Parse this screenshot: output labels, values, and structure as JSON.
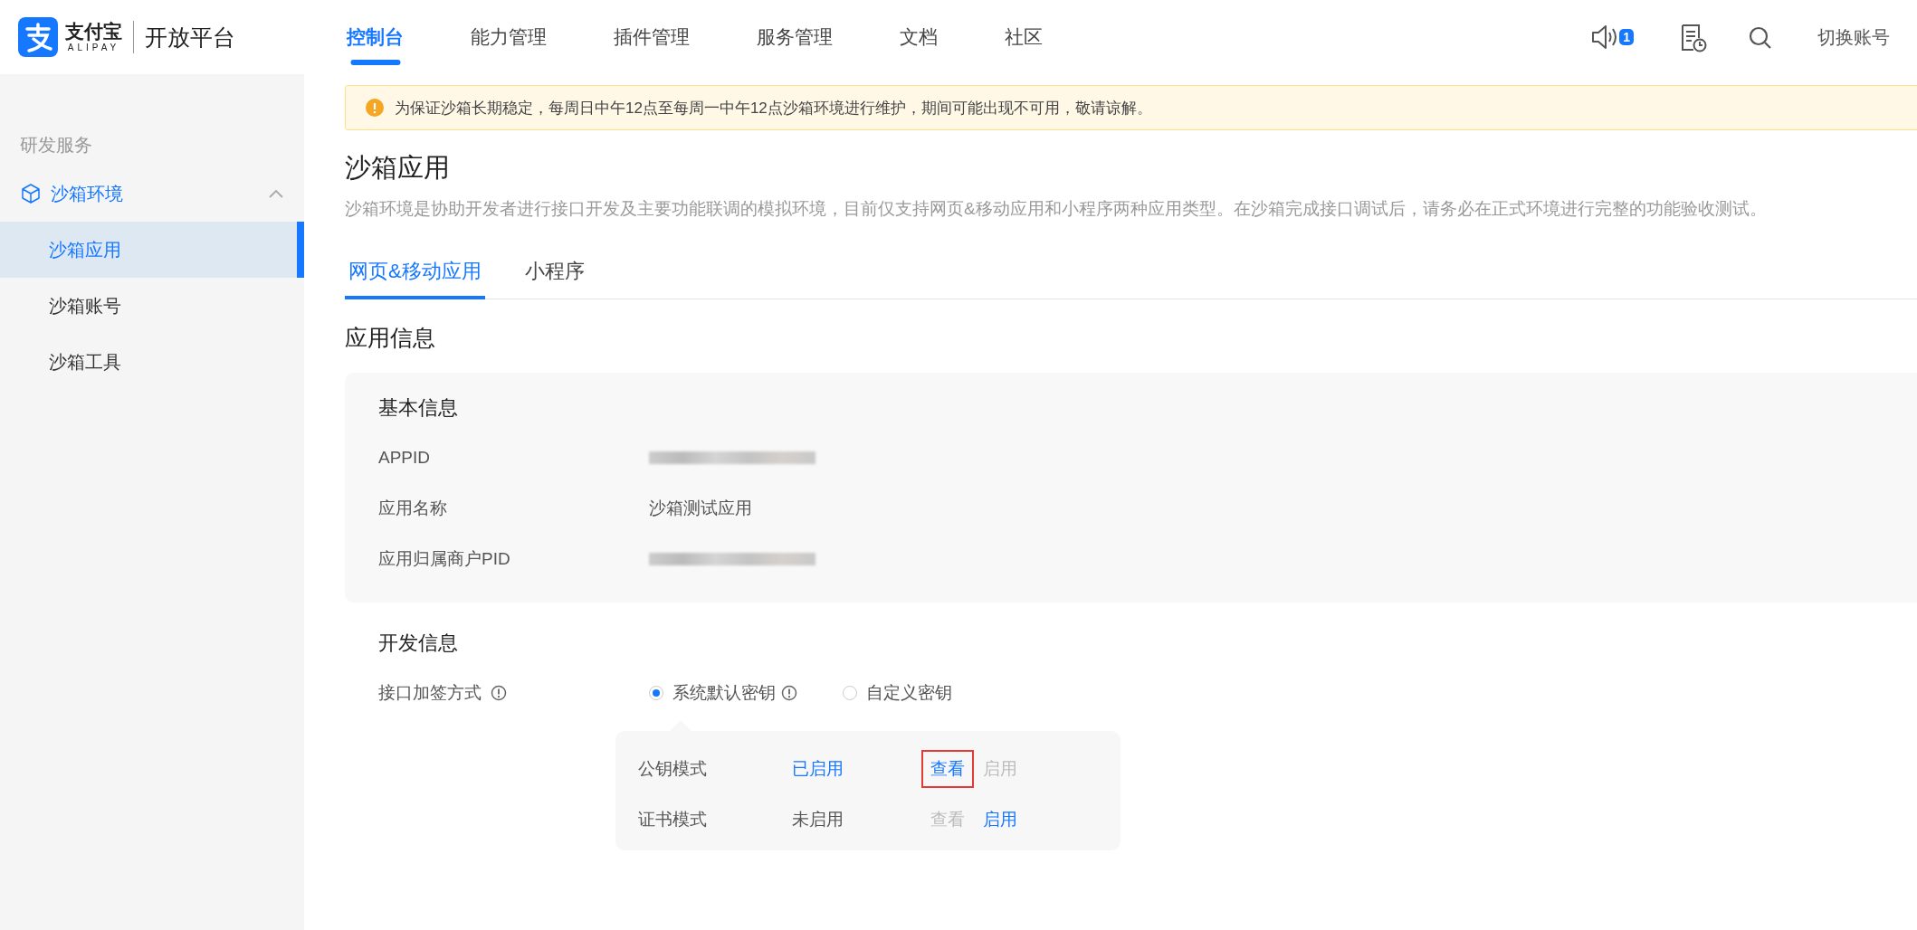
{
  "header": {
    "logo": {
      "name": "支付宝",
      "sub": "ALIPAY"
    },
    "platform": "开放平台",
    "nav": [
      {
        "label": "控制台",
        "selected": true
      },
      {
        "label": "能力管理",
        "selected": false
      },
      {
        "label": "插件管理",
        "selected": false
      },
      {
        "label": "服务管理",
        "selected": false
      },
      {
        "label": "文档",
        "selected": false
      },
      {
        "label": "社区",
        "selected": false
      }
    ],
    "notification_count": "1",
    "switch_account": "切换账号"
  },
  "sidebar": {
    "section": "研发服务",
    "groups": [
      {
        "label": "沙箱环境",
        "expanded": true,
        "children": [
          {
            "label": "沙箱应用",
            "selected": true
          },
          {
            "label": "沙箱账号",
            "selected": false
          },
          {
            "label": "沙箱工具",
            "selected": false
          }
        ]
      }
    ]
  },
  "notice": "为保证沙箱长期稳定，每周日中午12点至每周一中午12点沙箱环境进行维护，期间可能出现不可用，敬请谅解。",
  "page": {
    "title": "沙箱应用",
    "description": "沙箱环境是协助开发者进行接口开发及主要功能联调的模拟环境，目前仅支持网页&移动应用和小程序两种应用类型。在沙箱完成接口调试后，请务必在正式环境进行完整的功能验收测试。",
    "tabs": [
      {
        "label": "网页&移动应用",
        "selected": true
      },
      {
        "label": "小程序",
        "selected": false
      }
    ],
    "section_title": "应用信息",
    "basic_info": {
      "title": "基本信息",
      "fields": [
        {
          "label": "APPID",
          "redacted": true
        },
        {
          "label": "应用名称",
          "value": "沙箱测试应用"
        },
        {
          "label": "应用归属商户PID",
          "redacted": true
        }
      ]
    },
    "dev_info": {
      "title": "开发信息",
      "signing": {
        "label": "接口加签方式",
        "options": [
          {
            "label": "系统默认密钥",
            "selected": true,
            "info": true
          },
          {
            "label": "自定义密钥",
            "selected": false,
            "info": false
          }
        ]
      },
      "modes": [
        {
          "name": "公钥模式",
          "status": "已启用",
          "enabled": true,
          "actions": [
            {
              "label": "查看",
              "disabled": false,
              "highlighted": true
            },
            {
              "label": "启用",
              "disabled": true,
              "highlighted": false
            }
          ]
        },
        {
          "name": "证书模式",
          "status": "未启用",
          "enabled": false,
          "actions": [
            {
              "label": "查看",
              "disabled": true,
              "highlighted": false
            },
            {
              "label": "启用",
              "disabled": false,
              "highlighted": false
            }
          ]
        }
      ]
    }
  }
}
